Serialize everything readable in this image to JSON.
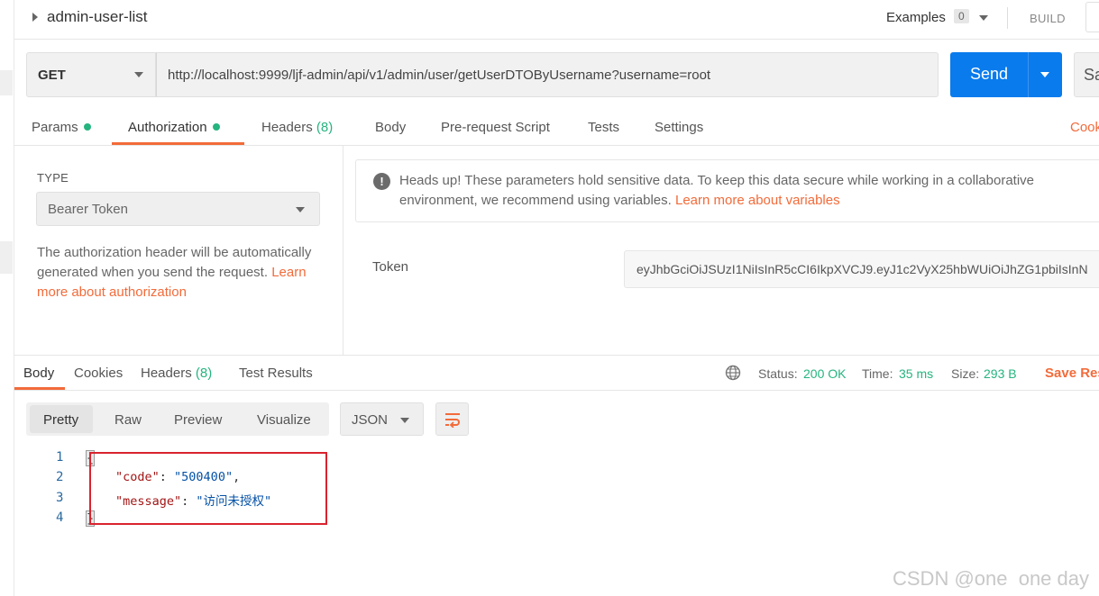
{
  "topbar": {
    "request_name": "admin-user-list",
    "examples_label": "Examples",
    "examples_count": "0",
    "build_label": "BUILD"
  },
  "request": {
    "method": "GET",
    "url": "http://localhost:9999/ljf-admin/api/v1/admin/user/getUserDTOByUsername?username=root",
    "send_label": "Send",
    "save_label": "Sa"
  },
  "request_tabs": {
    "params": "Params",
    "authorization": "Authorization",
    "headers": "Headers",
    "headers_count": "(8)",
    "body": "Body",
    "prerequest": "Pre-request Script",
    "tests": "Tests",
    "settings": "Settings",
    "cookies": "Cook"
  },
  "auth": {
    "type_label": "TYPE",
    "type_value": "Bearer Token",
    "description": "The authorization header will be automatically generated when you send the request.",
    "learn_more": "Learn more about authorization",
    "alert_text": "Heads up! These parameters hold sensitive data. To keep this data secure while working in a collaborative environment, we recommend using variables.",
    "alert_link": "Learn more about variables",
    "token_label": "Token",
    "token_value": "eyJhbGciOiJSUzI1NiIsInR5cCI6IkpXVCJ9.eyJ1c2VyX25hbWUiOiJhZG1pbiIsInN"
  },
  "response_tabs": {
    "body": "Body",
    "cookies": "Cookies",
    "headers": "Headers",
    "headers_count": "(8)",
    "test_results": "Test Results"
  },
  "response_meta": {
    "status_label": "Status:",
    "status_value": "200 OK",
    "time_label": "Time:",
    "time_value": "35 ms",
    "size_label": "Size:",
    "size_value": "293 B",
    "save_response": "Save Res"
  },
  "view_modes": [
    "Pretty",
    "Raw",
    "Preview",
    "Visualize"
  ],
  "format": "JSON",
  "body_lines": {
    "ln1": "1",
    "ln2": "2",
    "ln3": "3",
    "ln4": "4",
    "open": "{",
    "close": "}",
    "code_key": "\"code\"",
    "code_val": "\"500400\"",
    "message_key": "\"message\"",
    "message_val": "\"访问未授权\""
  },
  "watermark": "CSDN @one  one day",
  "colors": {
    "accent": "#f26b3a",
    "send": "#097bed",
    "success": "#26b47f",
    "highlight_box": "#d9232e"
  }
}
